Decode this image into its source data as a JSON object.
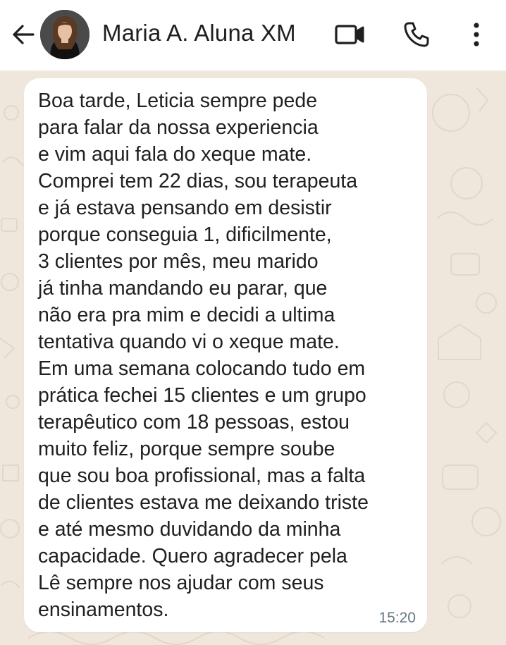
{
  "header": {
    "contact_name": "Maria A. Aluna XM",
    "icons": {
      "back": "arrow-back-icon",
      "video": "video-call-icon",
      "call": "phone-call-icon",
      "menu": "more-vert-icon"
    }
  },
  "message": {
    "text": "Boa tarde, Leticia sempre pede\npara falar da nossa experiencia\ne vim aqui fala do xeque mate.\nComprei tem 22 dias, sou terapeuta\ne já estava pensando em desistir\nporque conseguia 1, dificilmente,\n3 clientes por mês, meu marido\njá tinha mandando eu parar, que\nnão era pra mim e decidi a ultima\ntentativa quando vi o xeque mate.\nEm uma semana colocando tudo em\nprática fechei 15 clientes e um grupo\nterapêutico com 18 pessoas, estou\nmuito feliz, porque sempre soube\nque sou boa profissional, mas a falta\nde clientes estava me deixando triste\ne até mesmo duvidando da minha\ncapacidade. Quero agradecer pela\nLê sempre nos ajudar com seus\nensinamentos.",
    "time": "15:20"
  },
  "colors": {
    "header_bg": "#ffffff",
    "chat_bg": "#efe7dc",
    "bubble_bg": "#ffffff",
    "text": "#202020",
    "time": "#667781"
  }
}
